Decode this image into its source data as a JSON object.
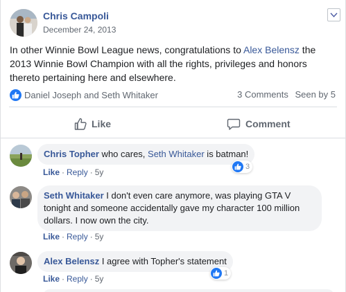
{
  "post": {
    "author": "Chris Campoli",
    "date": "December 24, 2013",
    "text_before": "In other Winnie Bowl League news, congratulations to ",
    "text_link": "Alex Belensz",
    "text_after": " the 2013 Winnie Bowl Champion with all the rights, privileges and honors thereto pertaining here and elsewhere.",
    "reactors": "Daniel Joseph and Seth Whitaker",
    "comments_count": "3 Comments",
    "seen_by": "Seen by 5",
    "like_label": "Like",
    "comment_label": "Comment"
  },
  "comments": [
    {
      "name": "Chris Topher",
      "text_before": " who cares, ",
      "mention": "Seth Whitaker",
      "text_after": " is batman!",
      "like": "Like",
      "reply": "Reply",
      "time": "5y",
      "reaction_count": "3"
    },
    {
      "name": "Seth Whitaker",
      "text": " I don't even care anymore, was playing GTA V tonight and someone accidentally gave my character 100 million dollars. I now own the city.",
      "like": "Like",
      "reply": "Reply",
      "time": "5y"
    },
    {
      "name": "Alex Belensz",
      "text": " I agree with Topher's statement",
      "like": "Like",
      "reply": "Reply",
      "time": "5y",
      "reaction_count": "1"
    }
  ],
  "colors": {
    "link": "#385898",
    "like_blue": "#2078f4",
    "bubble": "#f2f3f5",
    "secondary_text": "#606770"
  },
  "icons": [
    "thumbs-up-icon",
    "comment-icon",
    "chevron-down-icon",
    "like-reaction-icon"
  ]
}
